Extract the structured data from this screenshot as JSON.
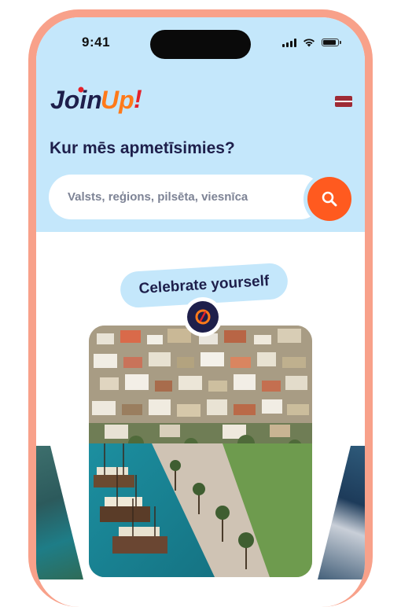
{
  "status_bar": {
    "time": "9:41",
    "icons": [
      "cellular-signal-icon",
      "wifi-icon",
      "battery-icon"
    ]
  },
  "brand": {
    "logo_text": "Join Up!",
    "colors": {
      "navy": "#1e1f4b",
      "orange": "#ff5a1f",
      "red": "#e4222b",
      "light_blue": "#c4e7fb",
      "phone_frame": "#f8a18a"
    }
  },
  "language": {
    "flag": "latvia-flag-icon"
  },
  "hero": {
    "title": "Kur mēs apmetīsimies?"
  },
  "search": {
    "placeholder": "Valsts, reģions, pilsēta, viesnīca",
    "value": "",
    "button_icon": "search-icon"
  },
  "promo": {
    "tagline": "Celebrate yourself",
    "badge_icon": "celebration-badge-icon",
    "image": "coastal-harbor-town-photo"
  }
}
